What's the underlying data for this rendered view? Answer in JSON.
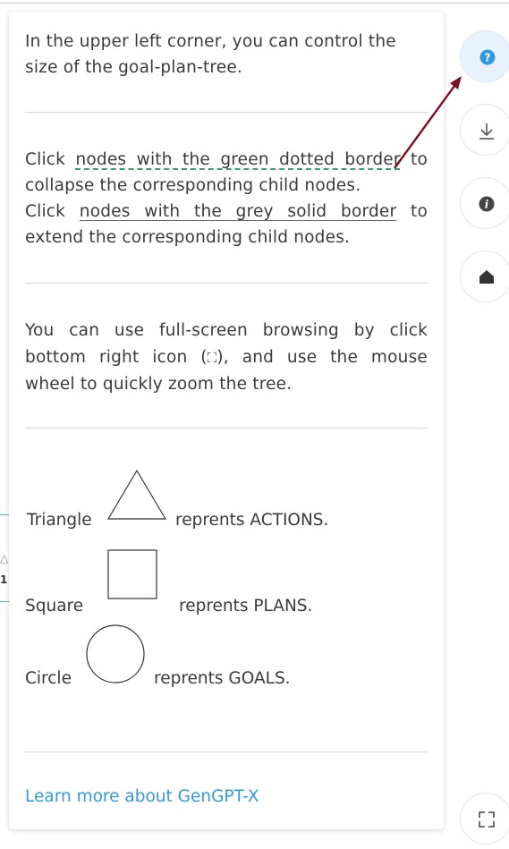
{
  "help": {
    "para1": "In the upper left corner, you can control the size of the goal-plan-tree.",
    "p2_click1": "Click ",
    "p2_green_link": "nodes with the green dotted border",
    "p2_rest1": " to collapse the corresponding child nodes.",
    "p2_click2": "Click ",
    "p2_grey_link": "nodes with the grey solid border",
    "p2_rest2": " to extend the corresponding child nodes.",
    "para3_a": "You can use full-screen browsing by click bottom right icon (",
    "para3_icon": "⛶",
    "para3_b": "), and use the mouse wheel to quickly zoom the tree.",
    "legend": {
      "triangle_label": "Triangle",
      "triangle_desc": "reprents ACTIONS.",
      "square_label": "Square",
      "square_desc": "reprents PLANS.",
      "circle_label": "Circle",
      "circle_desc": "reprents GOALS."
    },
    "learn_more": "Learn more about GenGPT-X"
  },
  "sidebar": {
    "help_icon": "question-icon",
    "download_icon": "download-icon",
    "info_icon": "info-icon",
    "home_icon": "home-icon",
    "fullscreen_icon": "fullscreen-icon"
  },
  "colors": {
    "accent": "#3399dd",
    "help_active_bg": "#e8f1fd",
    "arrow": "#7a1022",
    "dotted_border": "#3aa06c"
  },
  "background_fragment": "1"
}
